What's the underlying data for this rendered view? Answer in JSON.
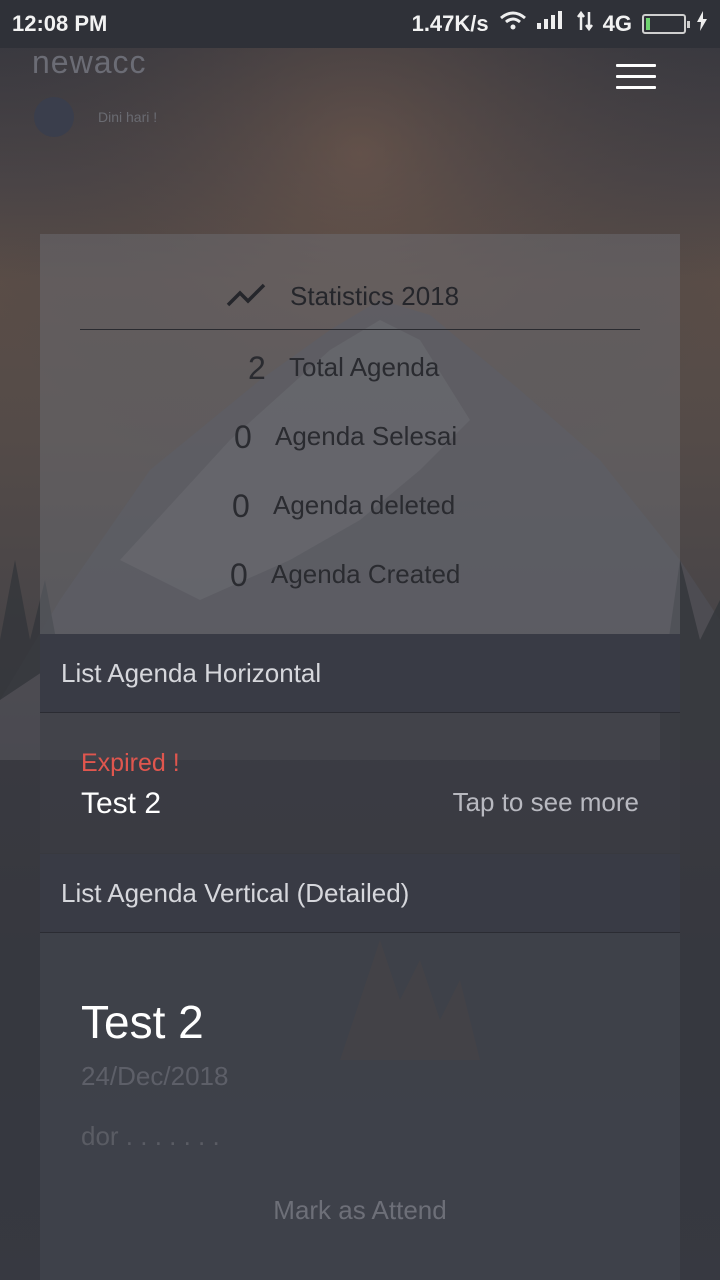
{
  "status_bar": {
    "time": "12:08 PM",
    "net_speed": "1.47K/s",
    "network": "4G",
    "icons": [
      "wifi-icon",
      "signal-icon",
      "data-arrows-icon",
      "battery-icon",
      "charging-icon"
    ]
  },
  "header": {
    "app_title": "newacc",
    "greeting": "Dini hari !",
    "menu_icon": "hamburger-menu-icon"
  },
  "stats": {
    "title": "Statistics 2018",
    "icon": "trending-icon",
    "rows": [
      {
        "value": "2",
        "label": "Total Agenda"
      },
      {
        "value": "0",
        "label": "Agenda Selesai"
      },
      {
        "value": "0",
        "label": "Agenda deleted"
      },
      {
        "value": "0",
        "label": "Agenda Created"
      }
    ]
  },
  "horizontal": {
    "header": "List Agenda Horizontal",
    "item": {
      "status": "Expired !",
      "name": "Test 2",
      "more": "Tap to see more"
    }
  },
  "vertical": {
    "header": "List Agenda Vertical (Detailed)",
    "item": {
      "name": "Test 2",
      "date": "24/Dec/2018",
      "description": "dor . . . . . . .",
      "action": "Mark as Attend"
    }
  },
  "colors": {
    "expired": "#e0564e",
    "section_header_bg": "#393b45",
    "status_bar_bg": "#2f3138"
  }
}
